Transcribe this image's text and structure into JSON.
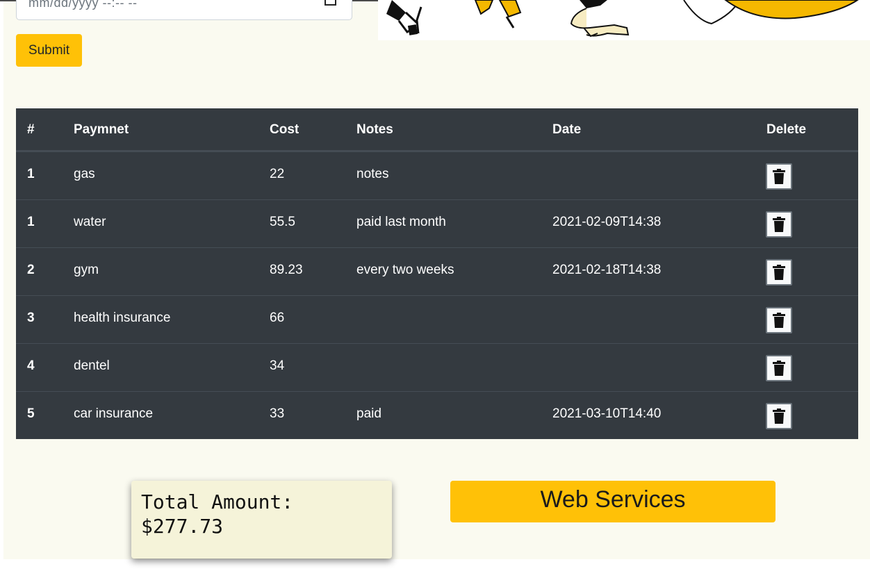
{
  "form": {
    "date_placeholder": "mm/dd/yyyy --:-- --",
    "submit_label": "Submit"
  },
  "table": {
    "headers": [
      "#",
      "Paymnet",
      "Cost",
      "Notes",
      "Date",
      "Delete"
    ],
    "rows": [
      {
        "num": "1",
        "payment": "gas",
        "cost": "22",
        "notes": "notes",
        "date": ""
      },
      {
        "num": "1",
        "payment": "water",
        "cost": "55.5",
        "notes": "paid last month",
        "date": "2021-02-09T14:38"
      },
      {
        "num": "2",
        "payment": "gym",
        "cost": "89.23",
        "notes": "every two weeks",
        "date": "2021-02-18T14:38"
      },
      {
        "num": "3",
        "payment": "health insurance",
        "cost": "66",
        "notes": "",
        "date": ""
      },
      {
        "num": "4",
        "payment": "dentel",
        "cost": "34",
        "notes": "",
        "date": ""
      },
      {
        "num": "5",
        "payment": "car insurance",
        "cost": "33",
        "notes": "paid",
        "date": "2021-03-10T14:40"
      }
    ]
  },
  "total": {
    "label": "Total Amount:",
    "value": "$277.73"
  },
  "web_services_label": "Web Services",
  "colors": {
    "accent": "#ffc107",
    "table_bg": "#343a40",
    "page_bg": "#fafaf0",
    "total_card_bg": "#f5f3d9"
  },
  "icons": {
    "delete": "trash-icon",
    "date_picker": "calendar-icon"
  }
}
